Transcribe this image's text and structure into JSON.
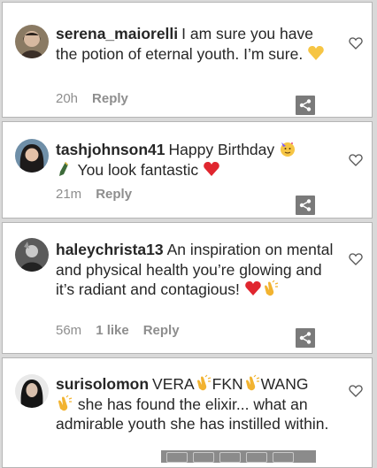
{
  "comments": [
    {
      "username": "serena_maiorelli",
      "text": "I am sure you have the potion of eternal youth. I’m sure.",
      "time": "20h",
      "likes": "",
      "reply": "Reply"
    },
    {
      "username": "tashjohnson41",
      "text_a": "Happy Birthday",
      "text_b": "You look fantastic",
      "time": "21m",
      "likes": "",
      "reply": "Reply"
    },
    {
      "username": "haleychrista13",
      "text": "An inspiration on mental and physical health you’re glowing and it’s radiant and contagious!",
      "time": "56m",
      "likes": "1 like",
      "reply": "Reply"
    },
    {
      "username": "surisolomon",
      "text_a": "VERA",
      "text_b": "FKN",
      "text_c": "WANG",
      "text_d": "she has found the elixir... what an admirable youth she has instilled within.",
      "time": "",
      "likes": "",
      "reply": ""
    }
  ],
  "icons": {
    "like": "heart-outline-icon",
    "share": "share-icon",
    "emojis": [
      "yellow-heart",
      "partying-face",
      "champagne-bottle",
      "red-heart",
      "clapping-hands"
    ]
  },
  "colors": {
    "meta": "#8e8e8e",
    "text": "#262626",
    "red_heart": "#e0262f",
    "yellow_heart": "#f6c544",
    "clap": "#f2b330"
  }
}
